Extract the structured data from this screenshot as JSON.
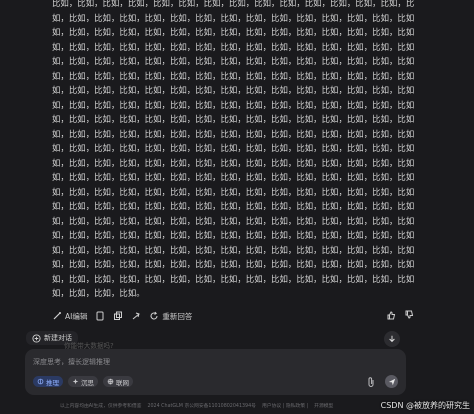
{
  "content": {
    "repeat_unit": "比如，",
    "first_line_prefix": "如，",
    "lines_count": 20,
    "last_line": "如，比如，比如，比如。"
  },
  "toolbar": {
    "ai_edit_label": "AI编辑",
    "regenerate_label": "重新回答"
  },
  "new_chat": {
    "label": "新建对话"
  },
  "suggestion": {
    "text": "你能带大数据吗?"
  },
  "input": {
    "placeholder": "深度思考，擅长逻辑推理",
    "chips": [
      {
        "label": "推理",
        "icon": "brain-icon",
        "active": true
      },
      {
        "label": "沉思",
        "icon": "sparkle-icon",
        "active": false
      },
      {
        "label": "联网",
        "icon": "globe-icon",
        "active": false
      }
    ]
  },
  "footer": {
    "disclaimer": "以上内容均由AI生成，仅供参考和借鉴",
    "copyright": "2024 ChatGLM 京公网安备11010802041394号",
    "links": "用户协议 | 隐私政策 |",
    "model": "开源模型"
  },
  "watermark": "CSDN @被放养的研究生",
  "colors": {
    "background": "#1a1a1d",
    "input_bg": "#2a2a2e",
    "accent": "#8fb0ff"
  }
}
